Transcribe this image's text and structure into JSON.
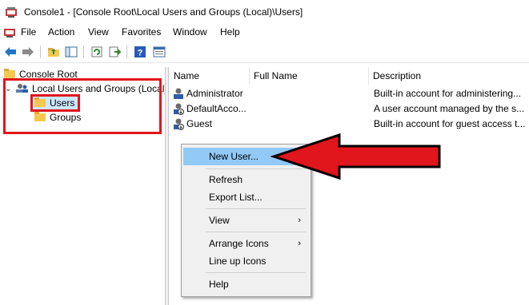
{
  "window": {
    "title": "Console1 - [Console Root\\Local Users and Groups (Local)\\Users]"
  },
  "menu": {
    "items": [
      "File",
      "Action",
      "View",
      "Favorites",
      "Window",
      "Help"
    ]
  },
  "toolbar": {
    "buttons": [
      "back-icon",
      "forward-icon",
      "up-folder-icon",
      "show-hide-tree-icon",
      "refresh-icon",
      "export-icon",
      "help-icon",
      "properties-icon"
    ]
  },
  "tree": {
    "root": "Console Root",
    "node": "Local Users and Groups (Local)",
    "children": [
      "Users",
      "Groups"
    ]
  },
  "list": {
    "columns": [
      "Name",
      "Full Name",
      "Description"
    ],
    "rows": [
      {
        "name": "Administrator",
        "full_name": "",
        "description": "Built-in account for administering..."
      },
      {
        "name": "DefaultAcco...",
        "full_name": "",
        "description": "A user account managed by the s..."
      },
      {
        "name": "Guest",
        "full_name": "",
        "description": "Built-in account for guest access t..."
      }
    ]
  },
  "context_menu": {
    "items": [
      "New User...",
      "Refresh",
      "Export List...",
      "View",
      "Arrange Icons",
      "Line up Icons",
      "Help"
    ]
  },
  "colors": {
    "highlight_red": "#e0161c",
    "menu_hover": "#91c9f7",
    "folder_yellow": "#f5c851"
  }
}
